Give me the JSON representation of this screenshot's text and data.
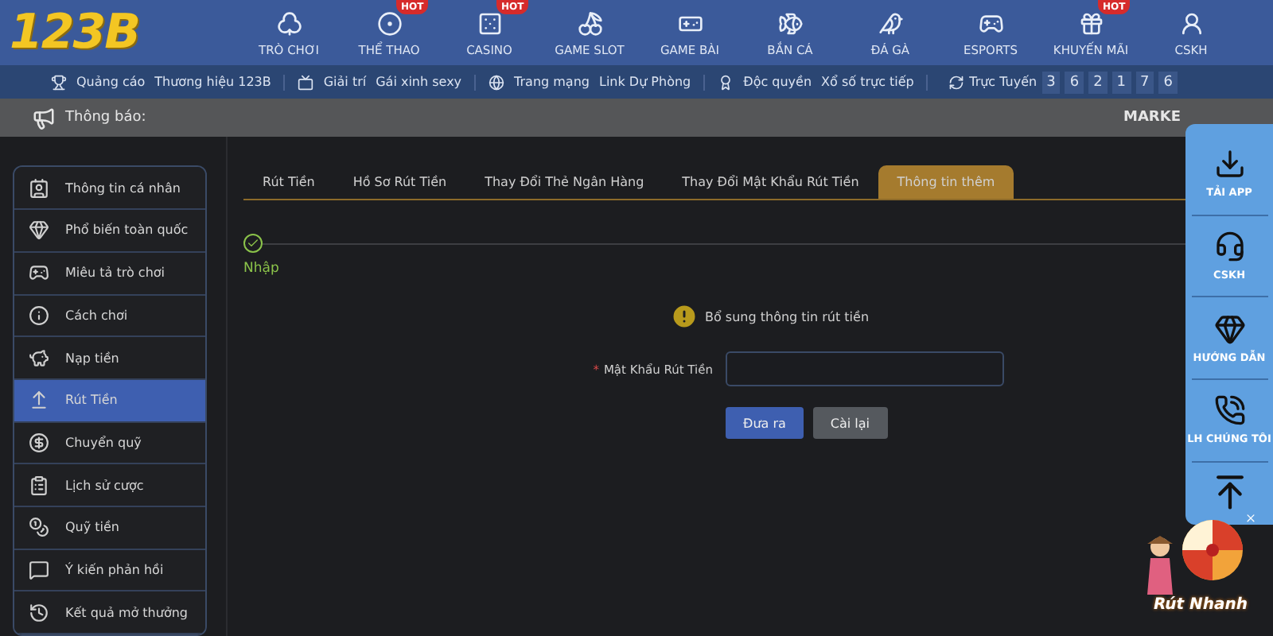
{
  "logo": {
    "text": "123B"
  },
  "nav": [
    {
      "label": "TRÒ CHƠI"
    },
    {
      "label": "THỂ THAO",
      "badge": "HOT"
    },
    {
      "label": "CASINO",
      "badge": "HOT"
    },
    {
      "label": "GAME SLOT"
    },
    {
      "label": "GAME BÀI"
    },
    {
      "label": "BẮN CÁ"
    },
    {
      "label": "ĐÁ GÀ"
    },
    {
      "label": "ESPORTS"
    },
    {
      "label": "KHUYẾN MÃI",
      "badge": "HOT"
    },
    {
      "label": "CSKH"
    }
  ],
  "info_bar": {
    "groups": [
      {
        "title": "Quảng cáo",
        "text": "Thương hiệu 123B"
      },
      {
        "title": "Giải trí",
        "text": "Gái xinh sexy"
      },
      {
        "title": "Trang mạng",
        "text": "Link Dự Phòng"
      },
      {
        "title": "Độc quyền",
        "text": "Xổ số trực tiếp"
      }
    ],
    "online_label": "Trực Tuyến",
    "online_digits": [
      "3",
      "6",
      "2",
      "1",
      "7",
      "6"
    ]
  },
  "notice": {
    "label": "Thông báo:",
    "marquee": "MARKE"
  },
  "sidebar": [
    {
      "label": "Thông tin cá nhân",
      "selected": false
    },
    {
      "label": "Phổ biến toàn quốc",
      "selected": false
    },
    {
      "label": "Miêu tả trò chơi",
      "selected": false
    },
    {
      "label": "Cách chơi",
      "selected": false
    },
    {
      "label": "Nạp tiền",
      "selected": false
    },
    {
      "label": "Rút Tiền",
      "selected": true
    },
    {
      "label": "Chuyển quỹ",
      "selected": false
    },
    {
      "label": "Lịch sử cược",
      "selected": false
    },
    {
      "label": "Quỹ tiền",
      "selected": false
    },
    {
      "label": "Ý kiến phản hồi",
      "selected": false
    },
    {
      "label": "Kết quả mở thưởng",
      "selected": false
    }
  ],
  "tabs": [
    {
      "label": "Rút Tiền",
      "selected": false
    },
    {
      "label": "Hồ Sơ Rút Tiền",
      "selected": false
    },
    {
      "label": "Thay Đổi Thẻ Ngân Hàng",
      "selected": false
    },
    {
      "label": "Thay Đổi Mật Khẩu Rút Tiền",
      "selected": false
    },
    {
      "label": "Thông tin thêm",
      "selected": true
    }
  ],
  "step": {
    "label": "Nhập",
    "done": true
  },
  "form": {
    "message": "Bổ sung thông tin rút tiền",
    "required_mark": "*",
    "field_label": "Mật Khẩu Rút Tiền",
    "submit": "Đưa ra",
    "reset": "Cài lại"
  },
  "float_panel": [
    {
      "label": "TẢI APP"
    },
    {
      "label": "CSKH"
    },
    {
      "label": "HƯỚNG DẪN"
    },
    {
      "label": "LH CHÚNG TÔI"
    }
  ],
  "promo": {
    "text": "Rút Nhanh"
  }
}
